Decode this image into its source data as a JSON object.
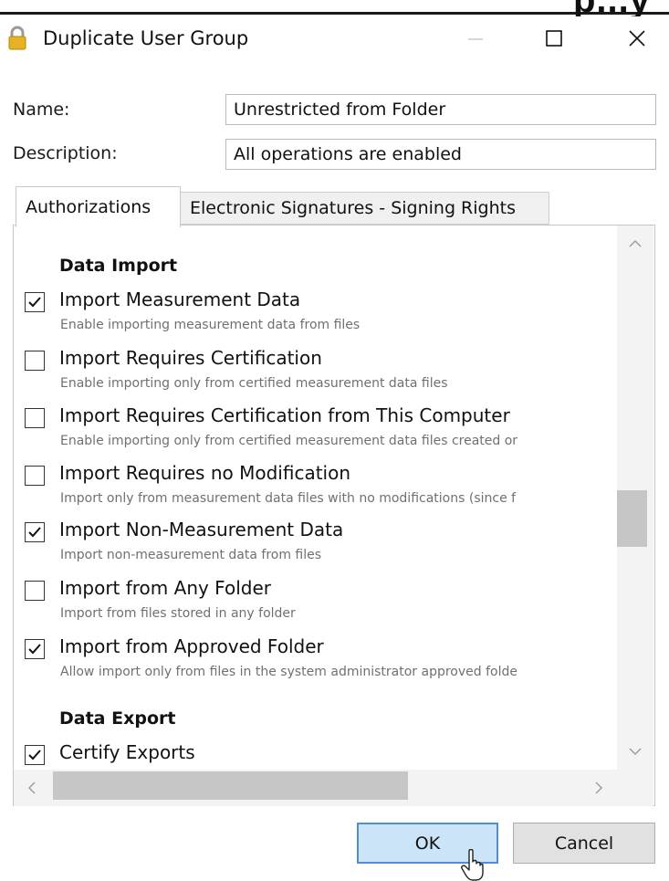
{
  "background_heading": "p...y",
  "window": {
    "title": "Duplicate User Group",
    "icon": "lock-icon",
    "controls": [
      "minimize-icon",
      "maximize-icon",
      "close-icon"
    ]
  },
  "form": {
    "name_label": "Name:",
    "name_value": "Unrestricted from Folder",
    "description_label": "Description:",
    "description_value": "All operations are enabled"
  },
  "tabs": [
    {
      "label": "Authorizations",
      "selected": true
    },
    {
      "label": "Electronic Signatures - Signing Rights",
      "selected": false
    }
  ],
  "sections": [
    {
      "heading": "Data Import",
      "items": [
        {
          "title": "Import Measurement Data",
          "description": "Enable importing measurement data from files",
          "checked": true
        },
        {
          "title": "Import Requires Certification",
          "description": "Enable importing only from certified measurement data files",
          "checked": false
        },
        {
          "title": "Import Requires Certification from This Computer",
          "description": "Enable importing only from certified measurement data files created or",
          "checked": false
        },
        {
          "title": "Import Requires no Modification",
          "description": "Import only from measurement data files with no modifications (since f",
          "checked": false
        },
        {
          "title": "Import Non-Measurement Data",
          "description": "Import non-measurement data from files",
          "checked": true
        },
        {
          "title": "Import from Any Folder",
          "description": "Import from files stored in any folder",
          "checked": false
        },
        {
          "title": "Import from Approved Folder",
          "description": "Allow import only from files in the system administrator approved folde",
          "checked": true
        }
      ]
    },
    {
      "heading": "Data Export",
      "items": [
        {
          "title": "Certify Exports",
          "description": "",
          "checked": true
        }
      ]
    }
  ],
  "scrollbar": {
    "vertical_position_fraction": 0.55,
    "horizontal_position_fraction": 0.0
  },
  "buttons": {
    "ok_label": "OK",
    "cancel_label": "Cancel"
  },
  "colors": {
    "ok_button_fill": "#cce4f7",
    "ok_button_border": "#4f8fcf",
    "lock_icon": "#e6b325"
  }
}
